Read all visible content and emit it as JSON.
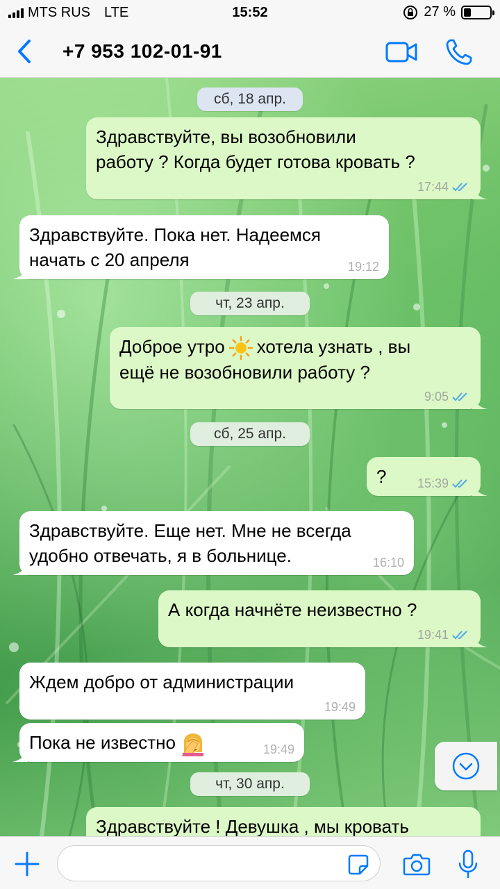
{
  "status_bar": {
    "carrier": "MTS RUS",
    "network": "LTE",
    "time": "15:52",
    "battery": "27 %",
    "battery_level": 0.27
  },
  "header": {
    "back_icon": "chevron-left-icon",
    "contact": "+7 953 102-01-91",
    "video_icon": "video-call-icon",
    "phone_icon": "phone-icon"
  },
  "chat": {
    "dates": [
      "сб, 18 апр.",
      "чт, 23 апр.",
      "сб, 25 апр.",
      "чт, 30 апр."
    ],
    "messages": [
      {
        "direction": "out",
        "lines": [
          "Здравствуйте, вы возобновили",
          "работу ? Когда будет готова кровать ?"
        ],
        "time": "17:44",
        "read": true
      },
      {
        "direction": "in",
        "lines": [
          "Здравствуйте.  Пока нет. Надеемся",
          "начать с 20 апреля"
        ],
        "time": "19:12"
      },
      {
        "direction": "out",
        "text_before": "Доброе утро",
        "emoji": "sun-emoji",
        "text_after": "хотела узнать , вы",
        "line2": "ещё не возобновили работу ?",
        "time": "9:05",
        "read": true
      },
      {
        "direction": "out",
        "text": "?",
        "time": "15:39",
        "read": true
      },
      {
        "direction": "in",
        "lines": [
          "Здравствуйте.  Еще нет. Мне не всегда",
          "удобно отвечать, я в больнице."
        ],
        "time": "16:10"
      },
      {
        "direction": "out",
        "text": "А когда начнёте неизвестно ?",
        "time": "19:41",
        "read": true
      },
      {
        "direction": "in",
        "text": "Ждем добро от администрации",
        "time": "19:49"
      },
      {
        "direction": "in",
        "text": "Пока не известно",
        "emoji": "facepalm-emoji",
        "time": "19:49"
      },
      {
        "direction": "out",
        "text": "Здравствуйте ! Девушка , мы кровать",
        "partial": true
      }
    ]
  },
  "input_bar": {
    "plus_icon": "plus-icon",
    "message_value": "",
    "sticker_icon": "sticker-icon",
    "camera_icon": "camera-icon",
    "mic_icon": "microphone-icon"
  },
  "colors": {
    "accent": "#007aff",
    "outgoing_bubble": "#dcf8c6",
    "incoming_bubble": "#ffffff",
    "read_ticks": "#4fa8e8"
  }
}
